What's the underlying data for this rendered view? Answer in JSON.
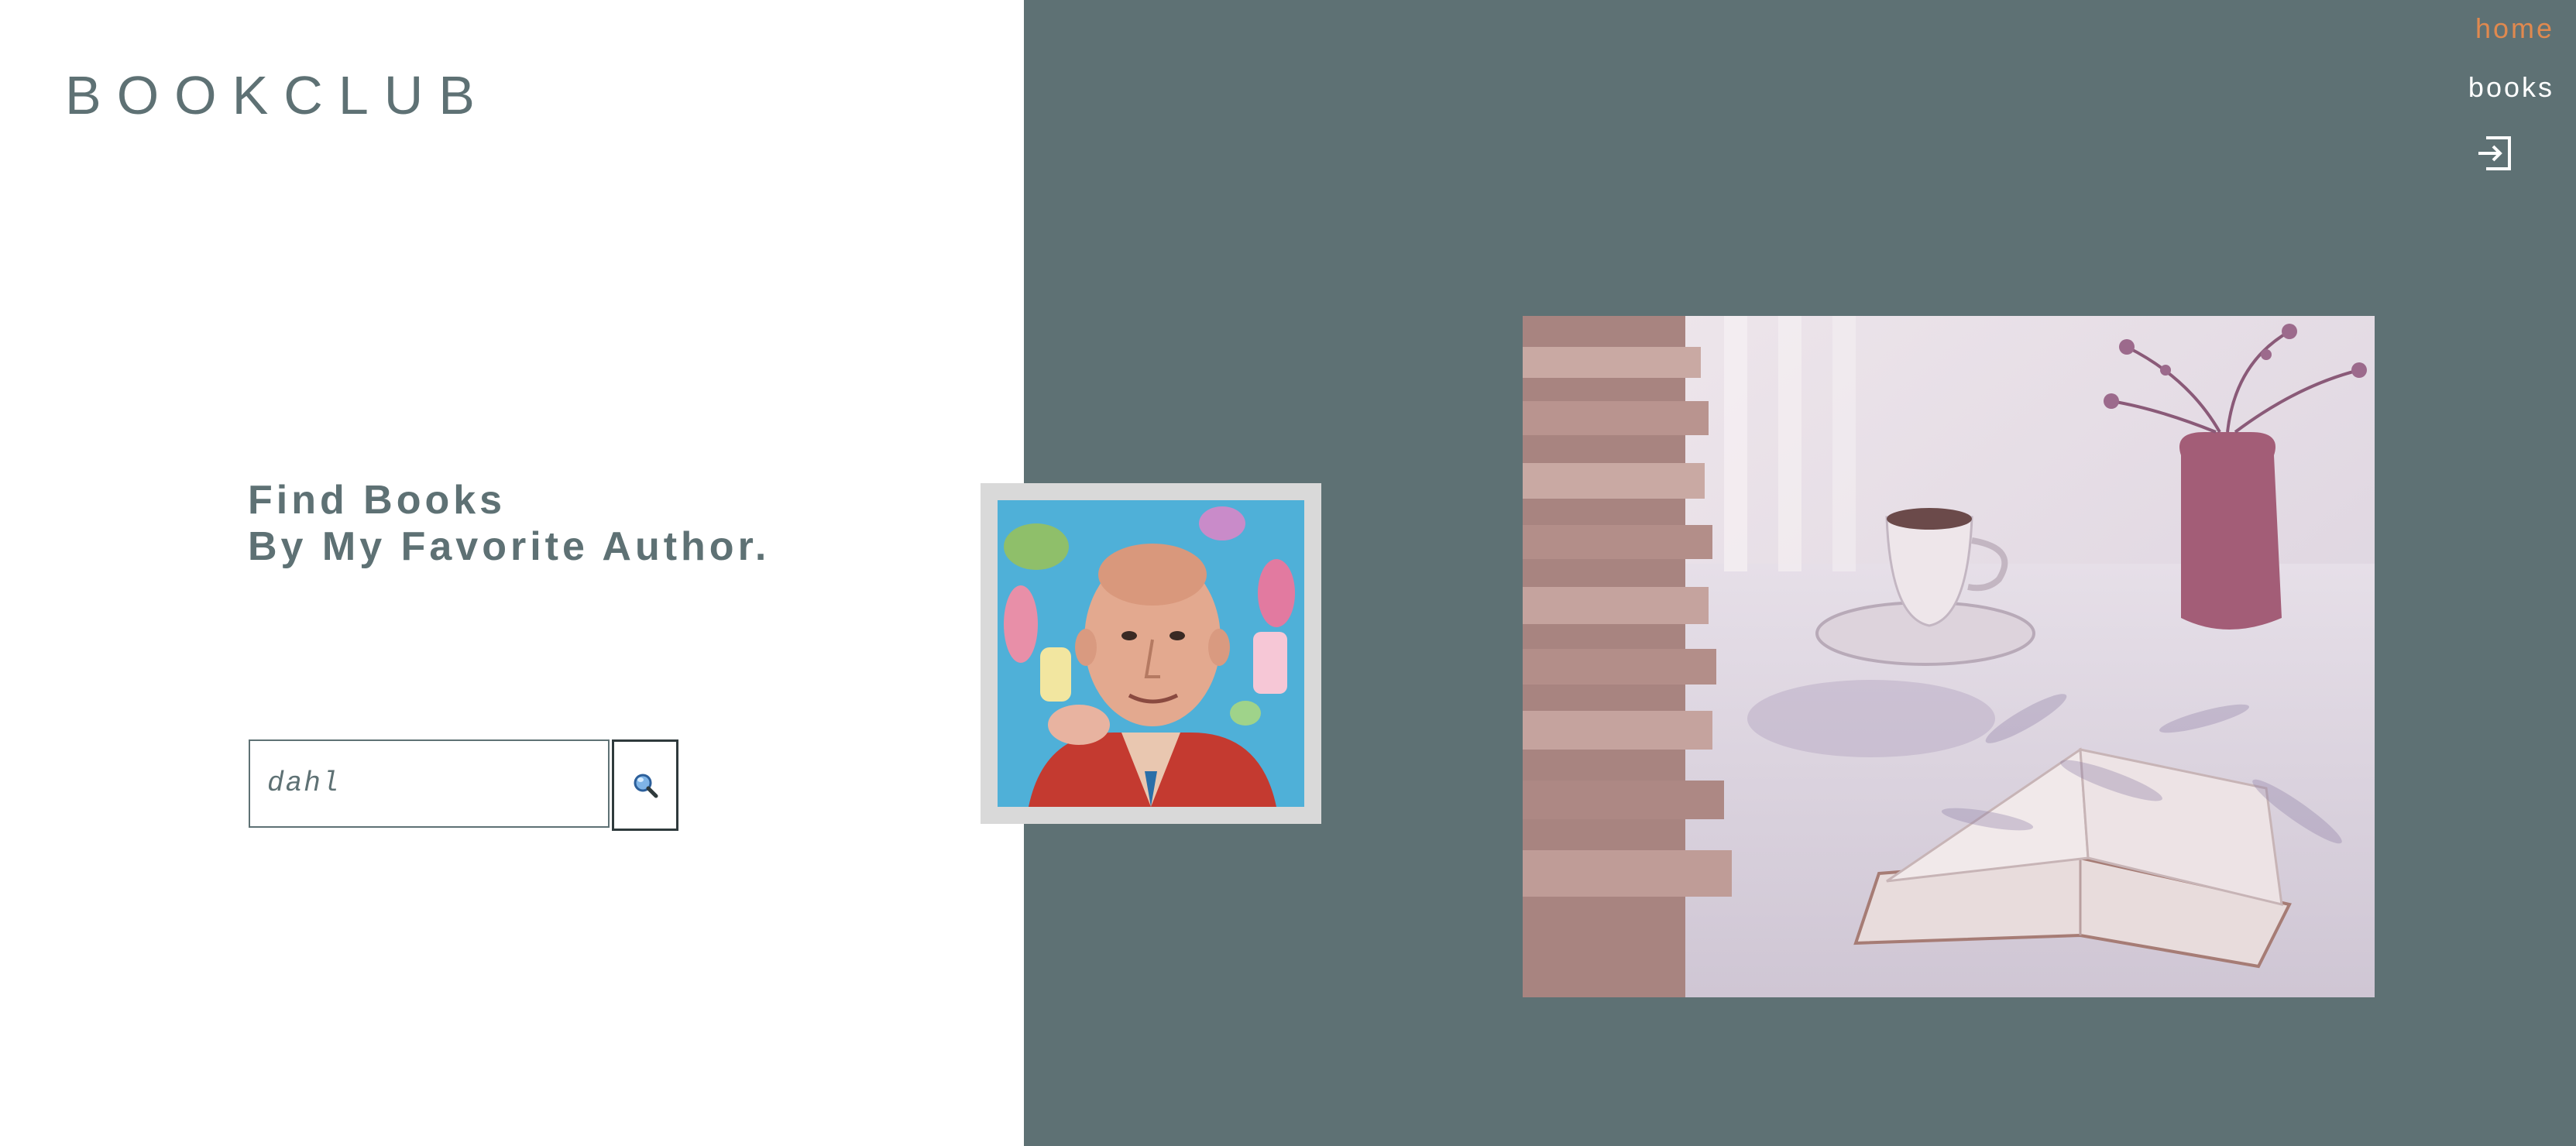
{
  "brand": {
    "logo": "BOOKCLUB"
  },
  "nav": {
    "items": [
      {
        "label": "home",
        "active": true
      },
      {
        "label": "books",
        "active": false
      }
    ],
    "login_icon": "sign-in-icon"
  },
  "hero": {
    "headline_line1": "Find Books",
    "headline_line2": "By My Favorite Author."
  },
  "search": {
    "value": "dahl",
    "button_icon": "magnifier-icon"
  },
  "images": {
    "portrait": "author-portrait",
    "photo": "books-and-tea-photo"
  },
  "colors": {
    "primary": "#5e7174",
    "accent": "#e0894f",
    "white": "#ffffff",
    "frame": "#d9d9d9"
  }
}
